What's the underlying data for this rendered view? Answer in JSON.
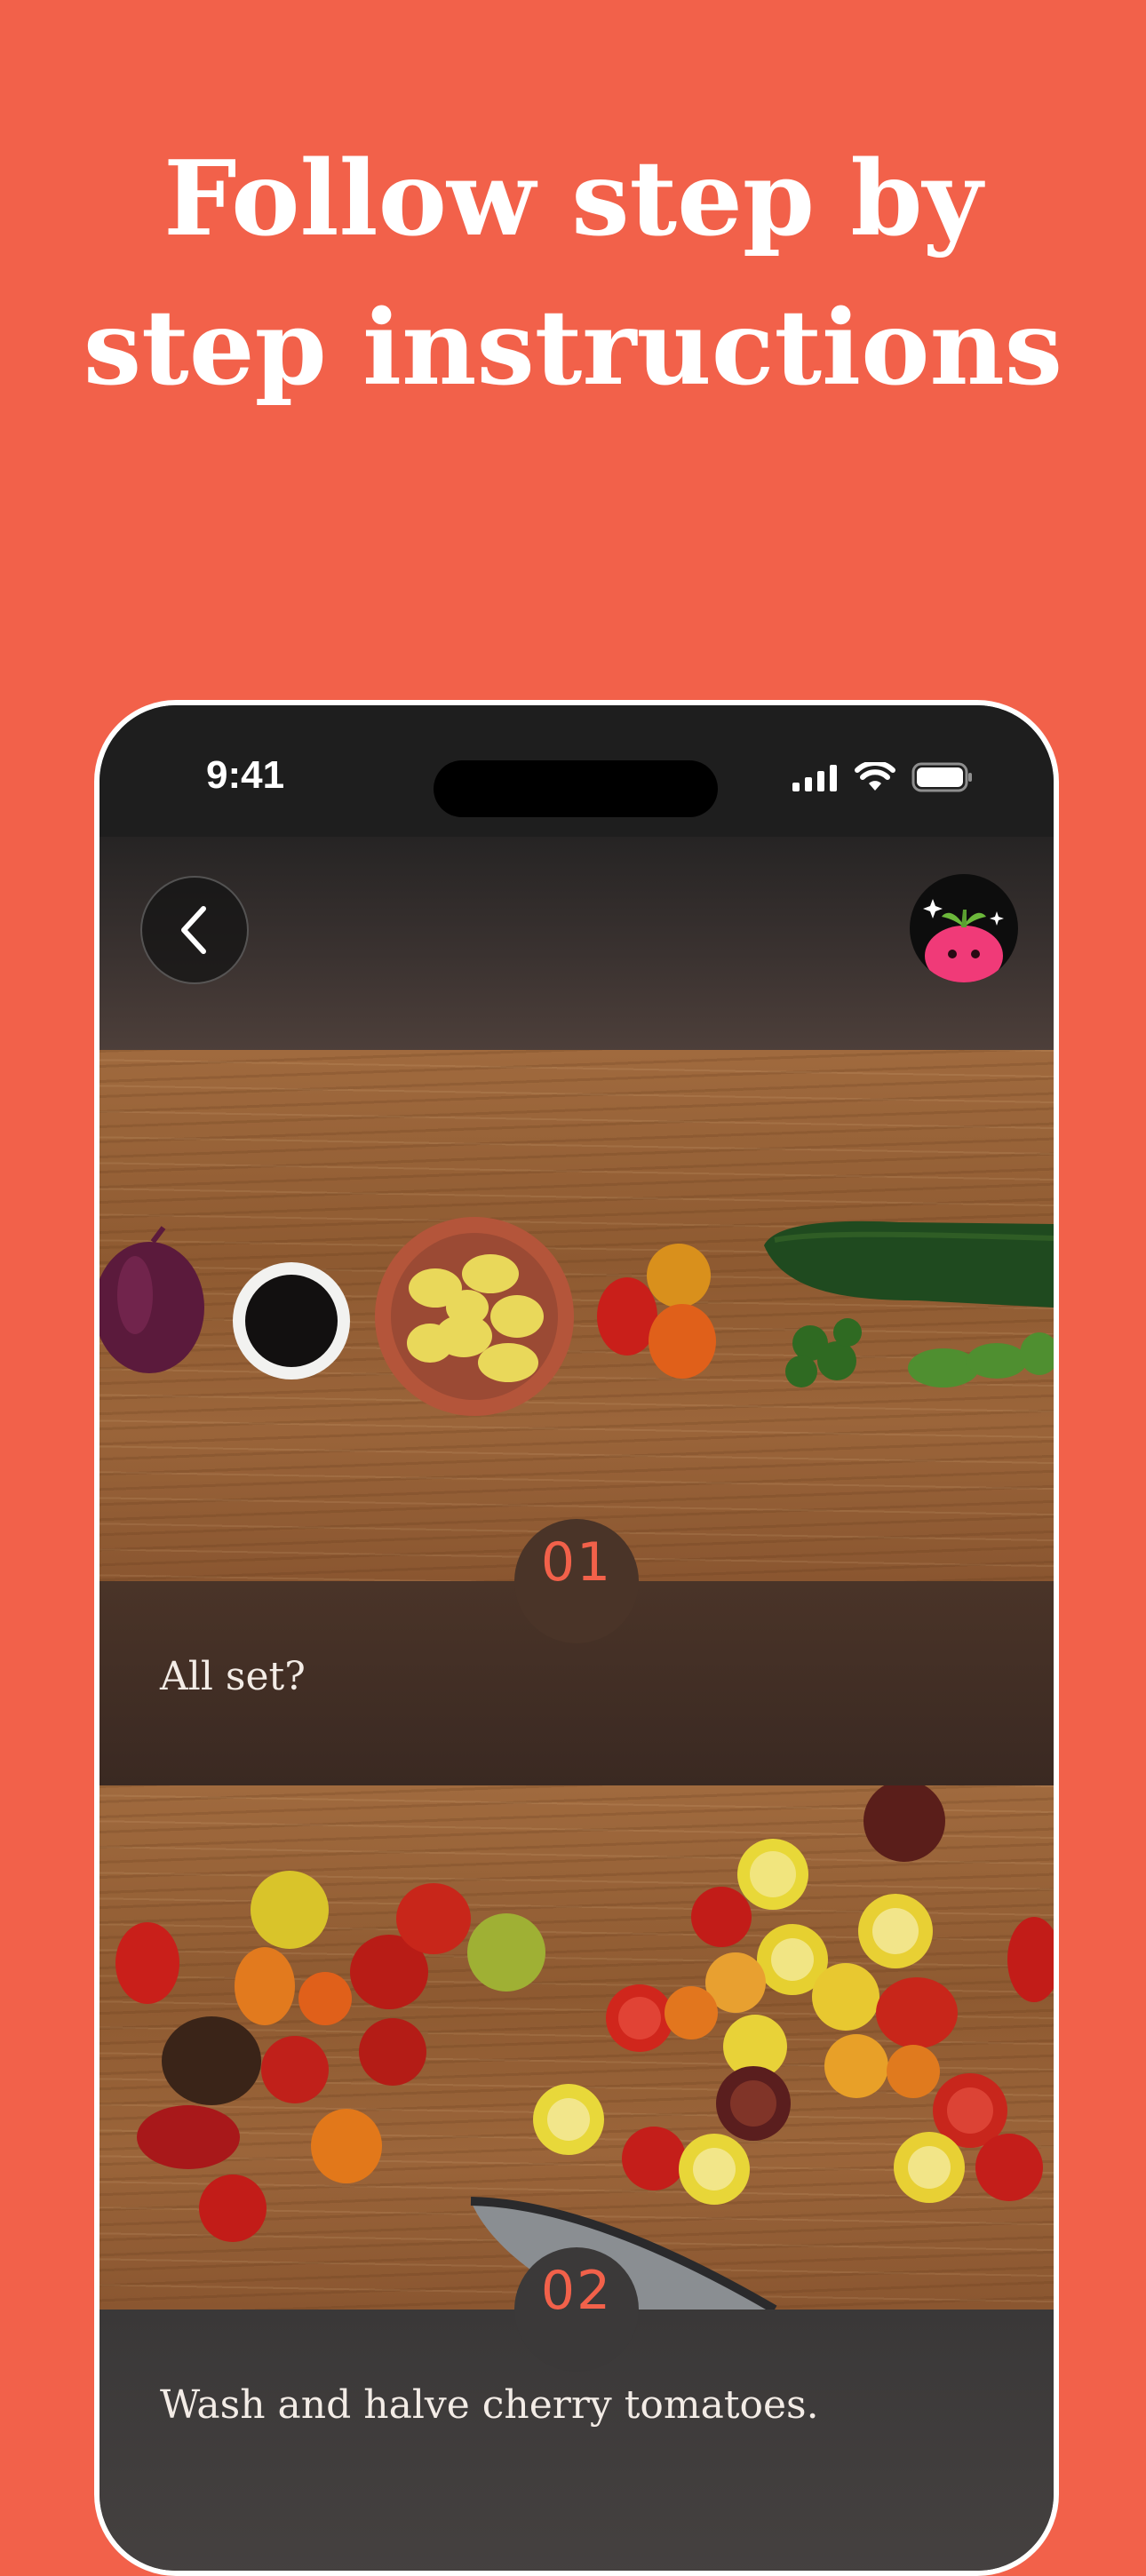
{
  "headline": {
    "line1": "Follow step by",
    "line2": "step instructions"
  },
  "colors": {
    "background": "#F2614A",
    "accent": "#F2614A",
    "phone_frame": "#FFFFFF"
  },
  "status_bar": {
    "time": "9:41",
    "icons": [
      "signal-icon",
      "wifi-icon",
      "battery-icon"
    ]
  },
  "header": {
    "back_icon": "chevron-left-icon",
    "avatar_icon": "radish-mascot-icon"
  },
  "steps": [
    {
      "number": "01",
      "text": "All set?",
      "image": "ingredients-on-wooden-table"
    },
    {
      "number": "02",
      "text": "Wash and halve cherry tomatoes.",
      "image": "halved-cherry-tomatoes-with-knife"
    }
  ]
}
